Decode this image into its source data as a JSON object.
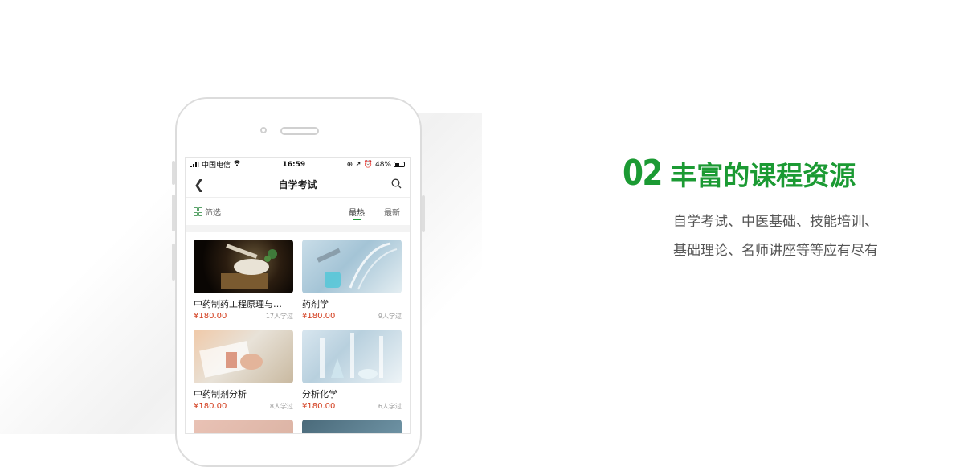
{
  "statusbar": {
    "carrier": "中国电信",
    "time": "16:59",
    "battery": "48%"
  },
  "navbar": {
    "title": "自学考试"
  },
  "filterbar": {
    "filter_label": "筛选",
    "sort_hot": "最热",
    "sort_new": "最新"
  },
  "courses": [
    {
      "title": "中药制药工程原理与…",
      "price": "¥180.00",
      "learners": "17人学过"
    },
    {
      "title": "药剂学",
      "price": "¥180.00",
      "learners": "9人学过"
    },
    {
      "title": "中药制剂分析",
      "price": "¥180.00",
      "learners": "8人学过"
    },
    {
      "title": "分析化学",
      "price": "¥180.00",
      "learners": "6人学过"
    }
  ],
  "headline": {
    "number": "02",
    "title": "丰富的课程资源"
  },
  "description": {
    "line1": "自学考试、中医基础、技能培训、",
    "line2": "基础理论、名师讲座等等应有尽有"
  },
  "colors": {
    "brand_green": "#1b9a33",
    "price_red": "#d23a1a"
  }
}
